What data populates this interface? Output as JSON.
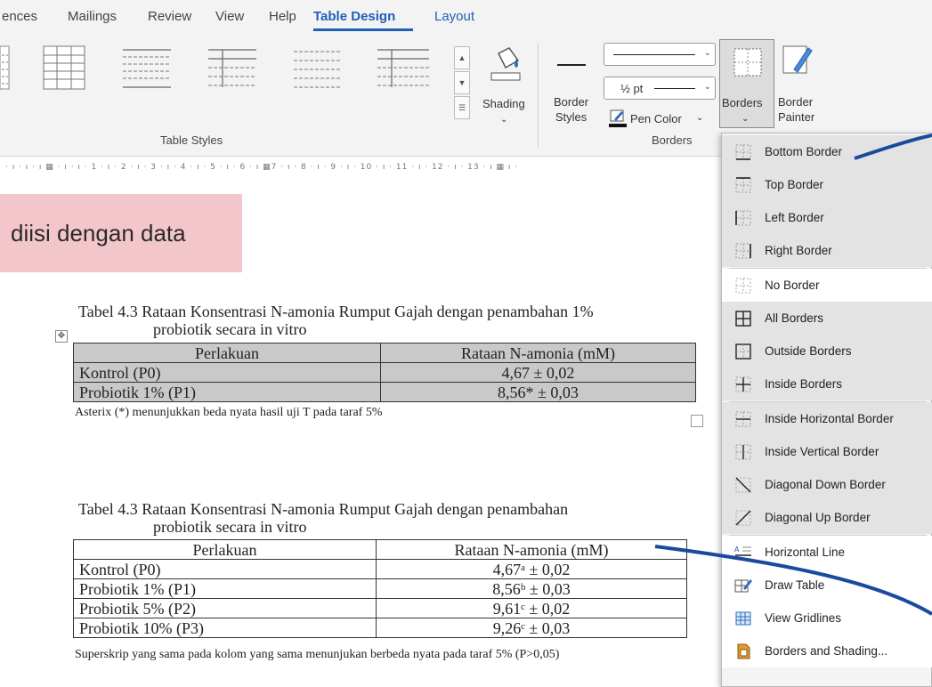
{
  "tabs": [
    "ences",
    "Mailings",
    "Review",
    "View",
    "Help",
    "Table Design",
    "Layout"
  ],
  "ribbon": {
    "table_styles_label": "Table Styles",
    "shading_label": "Shading",
    "border_styles_label": "Border\nStyles",
    "pen_weight": "½ pt",
    "pen_color_label": "Pen Color",
    "borders_label": "Borders",
    "border_painter_label": "Border\nPainter",
    "borders_group_label": "Borders"
  },
  "ruler": "· ı · ı · ı ▦ · ı · ı · 1 · ı · 2 · ı · 3 · ı · 4 · ı · 5 · ı · 6 · ı ▦7 · ı · 8 · ı · 9 · ı · 10 · ı · 11 · ı · 12 · ı · 13 · ı ▦ ı ·",
  "callout": "diisi dengan data",
  "table1": {
    "caption_line1": "Tabel 4.3 Rataan Konsentrasi N-amonia Rumput Gajah dengan penambahan 1%",
    "caption_line2": "probiotik secara in vitro",
    "headers": [
      "Perlakuan",
      "Rataan N-amonia (mM)"
    ],
    "rows": [
      [
        "Kontrol (P0)",
        "4,67   ± 0,02"
      ],
      [
        "Probiotik 1% (P1)",
        "8,56* ± 0,03"
      ]
    ],
    "note": "Asterix (*) menunjukkan beda nyata hasil uji T pada taraf 5%"
  },
  "table2": {
    "caption_line1": "Tabel 4.3 Rataan Konsentrasi N-amonia Rumput Gajah dengan penambahan",
    "caption_line2": "probiotik secara in vitro",
    "headers": [
      "Perlakuan",
      "Rataan N-amonia (mM)"
    ],
    "rows": [
      [
        "Kontrol (P0)",
        "4,67ᵃ ± 0,02"
      ],
      [
        "Probiotik 1% (P1)",
        "8,56ᵇ ± 0,03"
      ],
      [
        "Probiotik 5% (P2)",
        "9,61ᶜ ± 0,02"
      ],
      [
        "Probiotik 10% (P3)",
        "9,26ᶜ ± 0,03"
      ]
    ],
    "note": "Superskrip yang sama pada kolom yang sama menunjukan berbeda nyata pada taraf 5% (P>0,05)"
  },
  "borders_menu": {
    "items": [
      {
        "label": "Bottom Border",
        "icon": "bottom-border-icon"
      },
      {
        "label": "Top Border",
        "icon": "top-border-icon"
      },
      {
        "label": "Left Border",
        "icon": "left-border-icon"
      },
      {
        "label": "Right Border",
        "icon": "right-border-icon"
      },
      {
        "label": "No Border",
        "icon": "no-border-icon"
      },
      {
        "label": "All Borders",
        "icon": "all-borders-icon"
      },
      {
        "label": "Outside Borders",
        "icon": "outside-borders-icon"
      },
      {
        "label": "Inside Borders",
        "icon": "inside-borders-icon"
      },
      {
        "label": "Inside Horizontal Border",
        "icon": "inside-horizontal-border-icon"
      },
      {
        "label": "Inside Vertical Border",
        "icon": "inside-vertical-border-icon"
      },
      {
        "label": "Diagonal Down Border",
        "icon": "diagonal-down-border-icon"
      },
      {
        "label": "Diagonal Up Border",
        "icon": "diagonal-up-border-icon"
      },
      {
        "label": "Horizontal Line",
        "icon": "horizontal-line-icon"
      },
      {
        "label": "Draw Table",
        "icon": "draw-table-icon"
      },
      {
        "label": "View Gridlines",
        "icon": "view-gridlines-icon"
      },
      {
        "label": "Borders and Shading...",
        "icon": "borders-and-shading-icon"
      }
    ]
  },
  "colors": {
    "accent": "#1f5fb8",
    "annotation_arrow": "#1a4a9e",
    "callout_bg": "#f2c6cb",
    "table1_fill": "#c9c9c9"
  }
}
